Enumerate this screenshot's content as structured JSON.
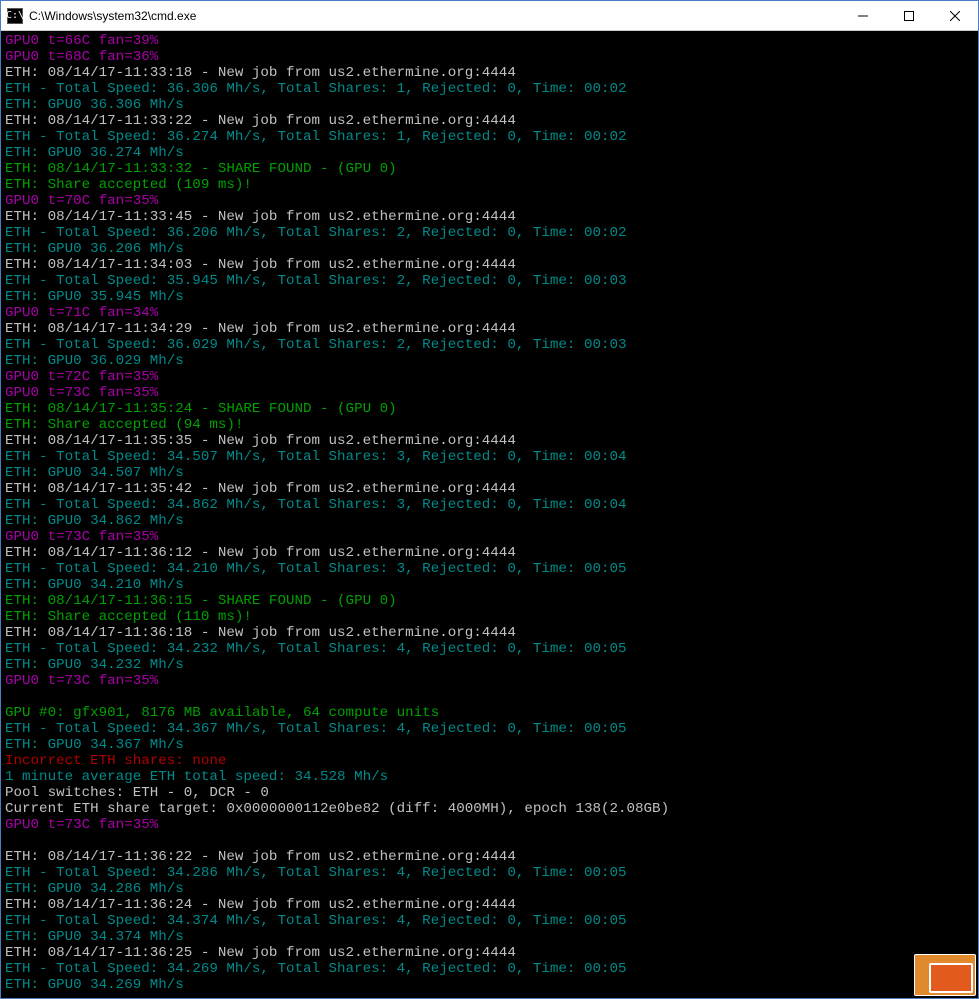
{
  "window": {
    "title": "C:\\Windows\\system32\\cmd.exe",
    "icon_glyph": "C:\\"
  },
  "lines": [
    {
      "cls": "c-mag",
      "text": "GPU0 t=66C fan=39%"
    },
    {
      "cls": "c-mag",
      "text": "GPU0 t=68C fan=36%"
    },
    {
      "cls": "c-wht",
      "text": "ETH: 08/14/17-11:33:18 - New job from us2.ethermine.org:4444"
    },
    {
      "cls": "c-teal",
      "text": "ETH - Total Speed: 36.306 Mh/s, Total Shares: 1, Rejected: 0, Time: 00:02"
    },
    {
      "cls": "c-teal",
      "text": "ETH: GPU0 36.306 Mh/s"
    },
    {
      "cls": "c-wht",
      "text": "ETH: 08/14/17-11:33:22 - New job from us2.ethermine.org:4444"
    },
    {
      "cls": "c-teal",
      "text": "ETH - Total Speed: 36.274 Mh/s, Total Shares: 1, Rejected: 0, Time: 00:02"
    },
    {
      "cls": "c-teal",
      "text": "ETH: GPU0 36.274 Mh/s"
    },
    {
      "cls": "c-grn",
      "text": "ETH: 08/14/17-11:33:32 - SHARE FOUND - (GPU 0)"
    },
    {
      "cls": "c-grn",
      "text": "ETH: Share accepted (109 ms)!"
    },
    {
      "cls": "c-mag",
      "text": "GPU0 t=70C fan=35%"
    },
    {
      "cls": "c-wht",
      "text": "ETH: 08/14/17-11:33:45 - New job from us2.ethermine.org:4444"
    },
    {
      "cls": "c-teal",
      "text": "ETH - Total Speed: 36.206 Mh/s, Total Shares: 2, Rejected: 0, Time: 00:02"
    },
    {
      "cls": "c-teal",
      "text": "ETH: GPU0 36.206 Mh/s"
    },
    {
      "cls": "c-wht",
      "text": "ETH: 08/14/17-11:34:03 - New job from us2.ethermine.org:4444"
    },
    {
      "cls": "c-teal",
      "text": "ETH - Total Speed: 35.945 Mh/s, Total Shares: 2, Rejected: 0, Time: 00:03"
    },
    {
      "cls": "c-teal",
      "text": "ETH: GPU0 35.945 Mh/s"
    },
    {
      "cls": "c-mag",
      "text": "GPU0 t=71C fan=34%"
    },
    {
      "cls": "c-wht",
      "text": "ETH: 08/14/17-11:34:29 - New job from us2.ethermine.org:4444"
    },
    {
      "cls": "c-teal",
      "text": "ETH - Total Speed: 36.029 Mh/s, Total Shares: 2, Rejected: 0, Time: 00:03"
    },
    {
      "cls": "c-teal",
      "text": "ETH: GPU0 36.029 Mh/s"
    },
    {
      "cls": "c-mag",
      "text": "GPU0 t=72C fan=35%"
    },
    {
      "cls": "c-mag",
      "text": "GPU0 t=73C fan=35%"
    },
    {
      "cls": "c-grn",
      "text": "ETH: 08/14/17-11:35:24 - SHARE FOUND - (GPU 0)"
    },
    {
      "cls": "c-grn",
      "text": "ETH: Share accepted (94 ms)!"
    },
    {
      "cls": "c-wht",
      "text": "ETH: 08/14/17-11:35:35 - New job from us2.ethermine.org:4444"
    },
    {
      "cls": "c-teal",
      "text": "ETH - Total Speed: 34.507 Mh/s, Total Shares: 3, Rejected: 0, Time: 00:04"
    },
    {
      "cls": "c-teal",
      "text": "ETH: GPU0 34.507 Mh/s"
    },
    {
      "cls": "c-wht",
      "text": "ETH: 08/14/17-11:35:42 - New job from us2.ethermine.org:4444"
    },
    {
      "cls": "c-teal",
      "text": "ETH - Total Speed: 34.862 Mh/s, Total Shares: 3, Rejected: 0, Time: 00:04"
    },
    {
      "cls": "c-teal",
      "text": "ETH: GPU0 34.862 Mh/s"
    },
    {
      "cls": "c-mag",
      "text": "GPU0 t=73C fan=35%"
    },
    {
      "cls": "c-wht",
      "text": "ETH: 08/14/17-11:36:12 - New job from us2.ethermine.org:4444"
    },
    {
      "cls": "c-teal",
      "text": "ETH - Total Speed: 34.210 Mh/s, Total Shares: 3, Rejected: 0, Time: 00:05"
    },
    {
      "cls": "c-teal",
      "text": "ETH: GPU0 34.210 Mh/s"
    },
    {
      "cls": "c-grn",
      "text": "ETH: 08/14/17-11:36:15 - SHARE FOUND - (GPU 0)"
    },
    {
      "cls": "c-grn",
      "text": "ETH: Share accepted (110 ms)!"
    },
    {
      "cls": "c-wht",
      "text": "ETH: 08/14/17-11:36:18 - New job from us2.ethermine.org:4444"
    },
    {
      "cls": "c-teal",
      "text": "ETH - Total Speed: 34.232 Mh/s, Total Shares: 4, Rejected: 0, Time: 00:05"
    },
    {
      "cls": "c-teal",
      "text": "ETH: GPU0 34.232 Mh/s"
    },
    {
      "cls": "c-mag",
      "text": "GPU0 t=73C fan=35%"
    },
    {
      "cls": "c-wht",
      "text": ""
    },
    {
      "cls": "c-grn",
      "text": "GPU #0: gfx901, 8176 MB available, 64 compute units"
    },
    {
      "cls": "c-teal",
      "text": "ETH - Total Speed: 34.367 Mh/s, Total Shares: 4, Rejected: 0, Time: 00:05"
    },
    {
      "cls": "c-teal",
      "text": "ETH: GPU0 34.367 Mh/s"
    },
    {
      "cls": "c-red",
      "text": "Incorrect ETH shares: none"
    },
    {
      "cls": "c-teal",
      "text": "1 minute average ETH total speed: 34.528 Mh/s"
    },
    {
      "cls": "c-wht",
      "text": "Pool switches: ETH - 0, DCR - 0"
    },
    {
      "cls": "c-wht",
      "text": "Current ETH share target: 0x0000000112e0be82 (diff: 4000MH), epoch 138(2.08GB)"
    },
    {
      "cls": "c-mag",
      "text": "GPU0 t=73C fan=35%"
    },
    {
      "cls": "c-wht",
      "text": ""
    },
    {
      "cls": "c-wht",
      "text": "ETH: 08/14/17-11:36:22 - New job from us2.ethermine.org:4444"
    },
    {
      "cls": "c-teal",
      "text": "ETH - Total Speed: 34.286 Mh/s, Total Shares: 4, Rejected: 0, Time: 00:05"
    },
    {
      "cls": "c-teal",
      "text": "ETH: GPU0 34.286 Mh/s"
    },
    {
      "cls": "c-wht",
      "text": "ETH: 08/14/17-11:36:24 - New job from us2.ethermine.org:4444"
    },
    {
      "cls": "c-teal",
      "text": "ETH - Total Speed: 34.374 Mh/s, Total Shares: 4, Rejected: 0, Time: 00:05"
    },
    {
      "cls": "c-teal",
      "text": "ETH: GPU0 34.374 Mh/s"
    },
    {
      "cls": "c-wht",
      "text": "ETH: 08/14/17-11:36:25 - New job from us2.ethermine.org:4444"
    },
    {
      "cls": "c-teal",
      "text": "ETH - Total Speed: 34.269 Mh/s, Total Shares: 4, Rejected: 0, Time: 00:05"
    },
    {
      "cls": "c-teal",
      "text": "ETH: GPU0 34.269 Mh/s"
    }
  ]
}
